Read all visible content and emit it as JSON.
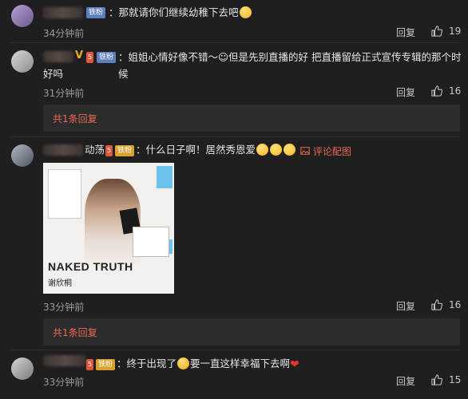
{
  "comments": [
    {
      "badge": "铁粉",
      "text": "：那就请你们继续幼稚下去吧",
      "time": "34分钟前",
      "reply": "回复",
      "likes": "19"
    },
    {
      "badge": "铁粉",
      "text_line1": "：姐姐心情好像不错～☺但是先别直播的好 把直播留给正式宣传专辑的那个时候",
      "text_line2": "好吗",
      "time": "31分钟前",
      "reply": "回复",
      "likes": "16",
      "replies_label": "共1条回复"
    },
    {
      "name_tail": "动荡",
      "badge": "铁粉",
      "text": "：什么日子啊！居然秀恩爱",
      "pic_link": "评论配图",
      "album_title": "NAKED TRUTH",
      "album_sub": "谢欣桐",
      "time": "33分钟前",
      "reply": "回复",
      "likes": "16",
      "replies_label": "共1条回复"
    },
    {
      "badge": "铁粉",
      "text_a": "：终于出现了",
      "text_b": "要一直这样幸福下去啊",
      "time": "33分钟前",
      "reply": "回复",
      "likes": "15"
    }
  ],
  "icons": {
    "like": "thumbs-up-icon",
    "picture": "image-icon"
  },
  "colors": {
    "accent": "#e96a54",
    "background": "#1f1f1f",
    "fan_badge": "#5e7fbf"
  }
}
